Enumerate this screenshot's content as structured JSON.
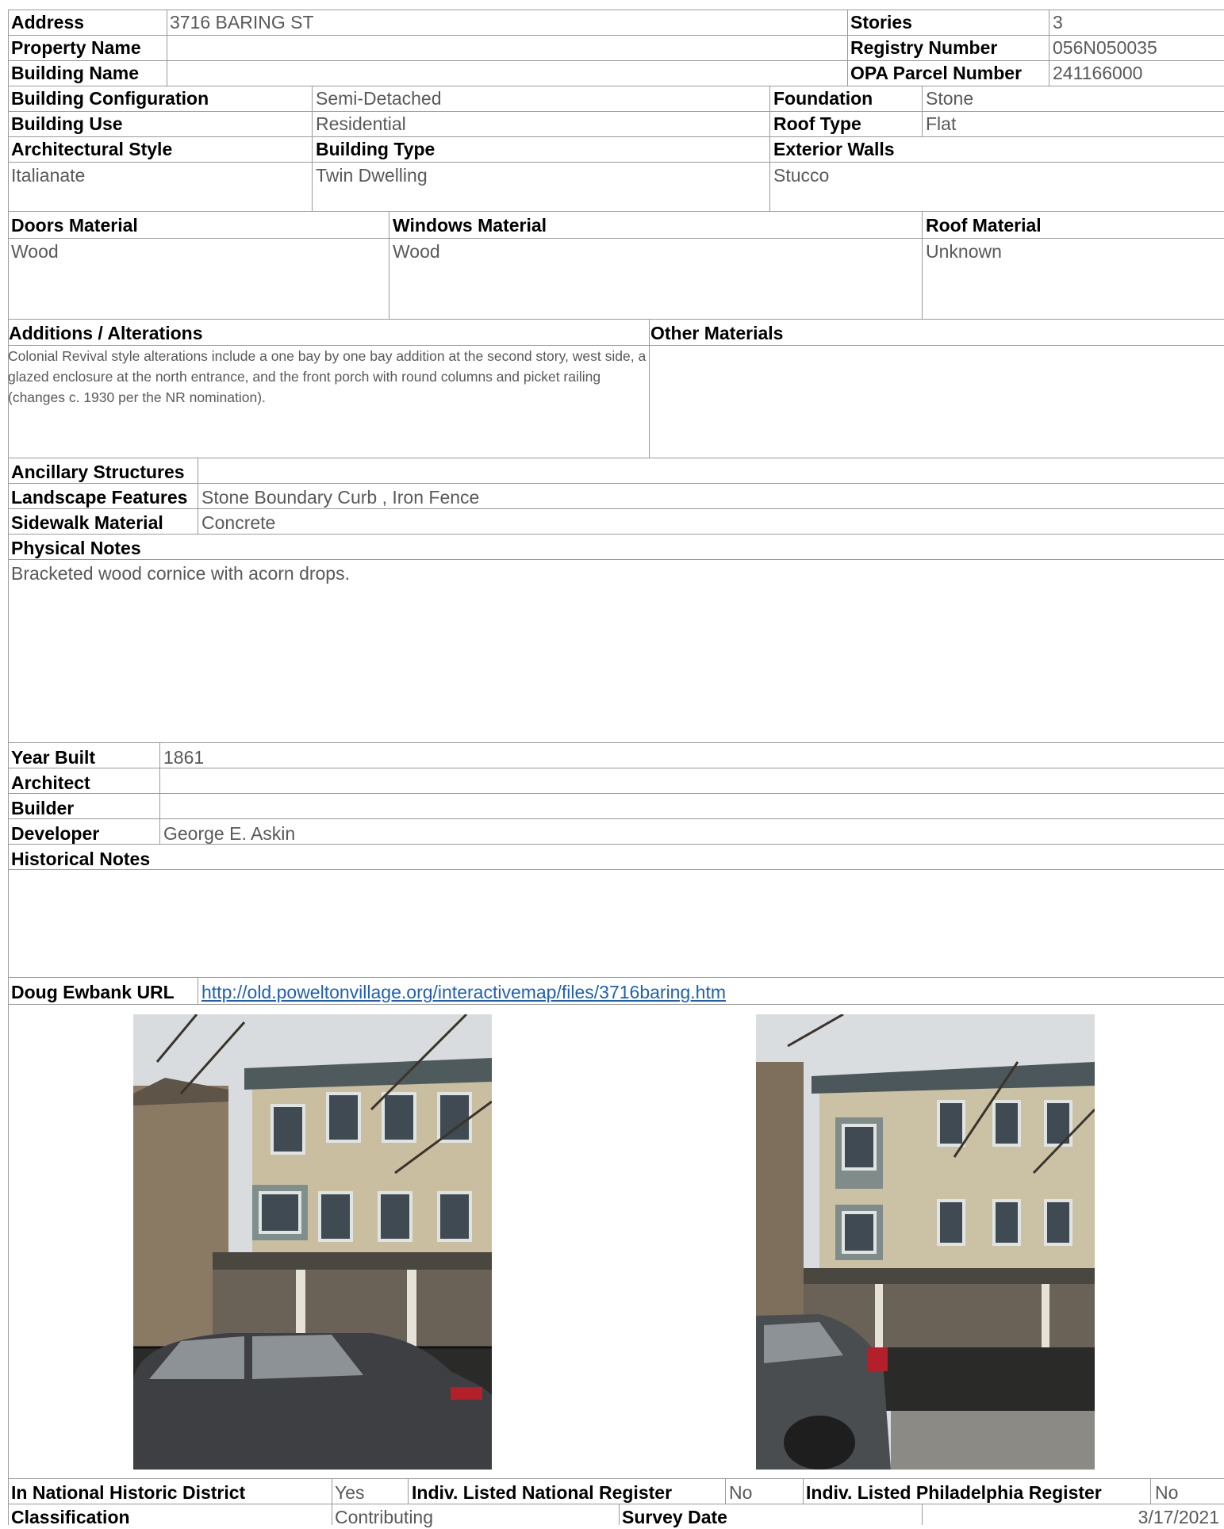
{
  "header": {
    "address_label": "Address",
    "address": "3716 BARING ST",
    "stories_label": "Stories",
    "stories": "3",
    "property_name_label": "Property Name",
    "property_name": "",
    "registry_label": "Registry Number",
    "registry": "056N050035",
    "building_name_label": "Building Name",
    "building_name": "",
    "opa_label": "OPA Parcel Number",
    "opa": "241166000"
  },
  "construction": {
    "config_label": "Building Configuration",
    "config": "Semi-Detached",
    "foundation_label": "Foundation",
    "foundation": "Stone",
    "use_label": "Building Use",
    "use": "Residential",
    "roof_type_label": "Roof Type",
    "roof_type": "Flat",
    "style_label": "Architectural Style",
    "style": "Italianate",
    "type_label": "Building Type",
    "type": "Twin Dwelling",
    "walls_label": "Exterior Walls",
    "walls": "Stucco"
  },
  "materials": {
    "doors_label": "Doors Material",
    "doors": "Wood",
    "windows_label": "Windows Material",
    "windows": "Wood",
    "roof_label": "Roof Material",
    "roof": "Unknown"
  },
  "additions": {
    "label": "Additions / Alterations",
    "text": "Colonial Revival style alterations include a one bay by one bay addition at the second story, west side, a glazed enclosure at the north entrance, and the front porch with round columns and picket railing (changes c. 1930 per the NR nomination).",
    "other_label": "Other Materials",
    "other": ""
  },
  "site": {
    "ancillary_label": "Ancillary Structures",
    "ancillary": "",
    "landscape_label": "Landscape Features",
    "landscape": "Stone Boundary Curb , Iron Fence",
    "sidewalk_label": "Sidewalk Material",
    "sidewalk": "Concrete",
    "physical_label": "Physical Notes",
    "physical": "Bracketed wood cornice with acorn drops."
  },
  "history": {
    "year_label": "Year Built",
    "year": "1861",
    "architect_label": "Architect",
    "architect": "",
    "builder_label": "Builder",
    "builder": "",
    "developer_label": "Developer",
    "developer": "George E. Askin",
    "notes_label": "Historical Notes",
    "notes": ""
  },
  "url": {
    "label": "Doug Ewbank URL",
    "link": "http://old.poweltonvillage.org/interactivemap/files/3716baring.htm"
  },
  "footer": {
    "district_label": "In National Historic District",
    "district": "Yes",
    "national_label": "Indiv. Listed National Register",
    "national": "No",
    "phila_label": "Indiv. Listed Philadelphia Register",
    "phila": "No",
    "class_label": "Classification",
    "class": "Contributing",
    "survey_label": "Survey Date",
    "survey": "3/17/2021"
  }
}
